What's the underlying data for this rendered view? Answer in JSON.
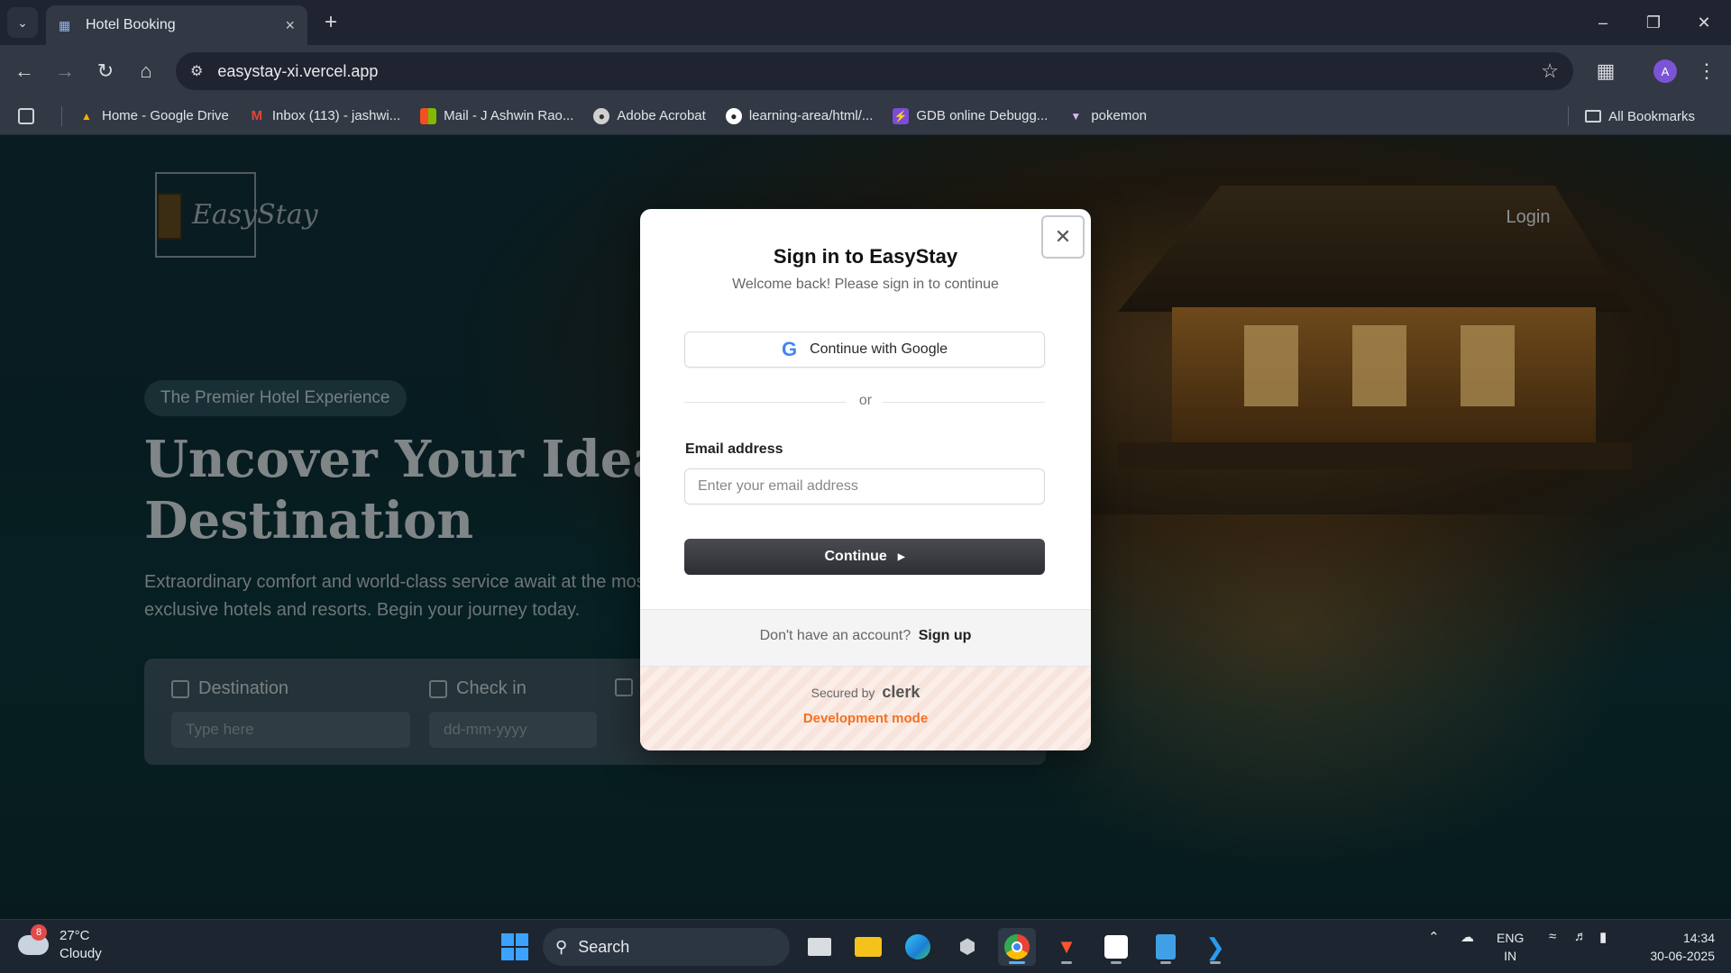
{
  "browser": {
    "tab_title": "Hotel Booking",
    "url": "easystay-xi.vercel.app",
    "avatar_letter": "A",
    "bookmarks": [
      {
        "label": "Home - Google Drive",
        "icon": "google-drive-icon",
        "color": "#f4b400"
      },
      {
        "label": "Inbox (113) - jashwi...",
        "icon": "gmail-icon",
        "color": "#ea4335"
      },
      {
        "label": "Mail - J Ashwin Rao...",
        "icon": "microsoft-icon",
        "color": "#f25022"
      },
      {
        "label": "Adobe Acrobat",
        "icon": "acrobat-icon",
        "color": "#cccccc"
      },
      {
        "label": "learning-area/html/...",
        "icon": "github-icon",
        "color": "#ffffff"
      },
      {
        "label": "GDB online Debugg...",
        "icon": "gdb-icon",
        "color": "#7b4dd6"
      },
      {
        "label": "pokemon",
        "icon": "pokemon-icon",
        "color": "#e0b3ff"
      }
    ],
    "all_bookmarks": "All Bookmarks"
  },
  "site": {
    "logo_text": "EasyStay",
    "login": "Login",
    "pill": "The Premier Hotel Experience",
    "hero_title": "Uncover Your Ideal Luxury Destination",
    "hero_sub": "Extraordinary comfort and world-class service await at the most exclusive hotels and resorts. Begin your journey today.",
    "search": {
      "destination_label": "Destination",
      "destination_placeholder": "Type here",
      "checkin_label": "Check in",
      "checkin_placeholder": "dd-mm-yyyy"
    }
  },
  "modal": {
    "title": "Sign in to EasyStay",
    "subtitle": "Welcome back! Please sign in to continue",
    "google_button": "Continue with Google",
    "or": "or",
    "email_label": "Email address",
    "email_placeholder": "Enter your email address",
    "continue_button": "Continue",
    "no_account": "Don't have an account?",
    "signup": "Sign up",
    "secured_by": "Secured by",
    "clerk": "clerk",
    "dev_mode": "Development mode"
  },
  "taskbar": {
    "weather_badge": "8",
    "temperature": "27°C",
    "condition": "Cloudy",
    "search": "Search",
    "lang_line1": "ENG",
    "lang_line2": "IN",
    "time": "14:34",
    "date": "30-06-2025"
  },
  "colors": {
    "accent_orange": "#f37021",
    "continue_dark": "#2d2e33"
  }
}
